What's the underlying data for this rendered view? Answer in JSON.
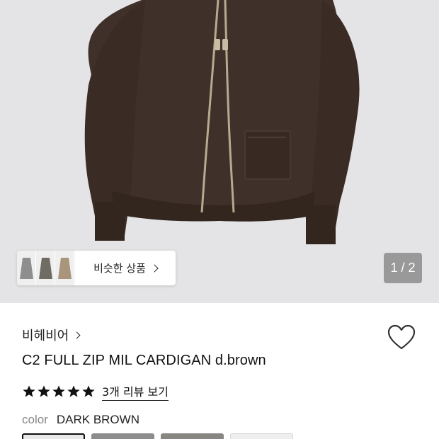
{
  "product_image": {
    "alt_icon": "cardigan-image",
    "pager": "1 / 2"
  },
  "similar": {
    "label": "비슷한 상품"
  },
  "brand": {
    "name": "비헤비어"
  },
  "product": {
    "title": "C2 FULL ZIP MIL CARDIGAN d.brown",
    "rating": 5,
    "review_link": "3개 리뷰 보기"
  },
  "color": {
    "label": "color",
    "value": "DARK BROWN",
    "swatches": [
      "light",
      "gray",
      "taupe",
      "white"
    ]
  },
  "colors": {
    "star": "#111111",
    "garment": "#3f3029",
    "background": "#e4e3e5"
  }
}
